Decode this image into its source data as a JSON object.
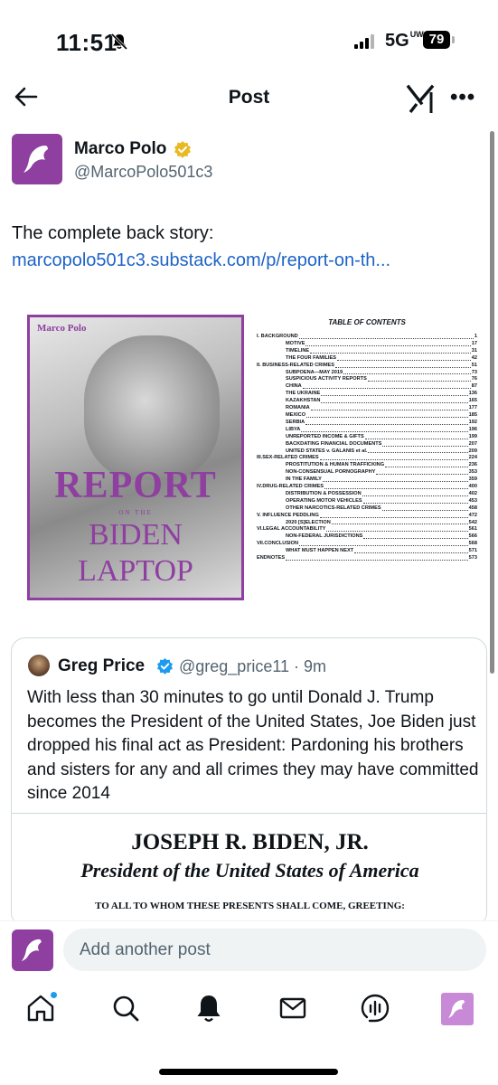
{
  "status_bar": {
    "time": "11:51",
    "network": "5G",
    "network_sub": "UW",
    "battery": "79"
  },
  "header": {
    "title": "Post"
  },
  "post": {
    "author_name": "Marco Polo",
    "author_handle": "@MarcoPolo501c3",
    "text": "The complete back story:",
    "link": "marcopolo501c3.substack.com/p/report-on-th..."
  },
  "media": {
    "cover": {
      "brand": "Marco Polo",
      "line1": "REPORT",
      "line2": "ON THE",
      "line3": "BIDEN",
      "line4": "LAPTOP"
    },
    "toc_title": "TABLE OF CONTENTS",
    "toc": [
      {
        "label": "I. BACKGROUND",
        "page": "1",
        "sub": false
      },
      {
        "label": "MOTIVE",
        "page": "17",
        "sub": true
      },
      {
        "label": "TIMELINE",
        "page": "31",
        "sub": true
      },
      {
        "label": "THE FOUR FAMILIES",
        "page": "42",
        "sub": true
      },
      {
        "label": "II. BUSINESS-RELATED CRIMES",
        "page": "51",
        "sub": false
      },
      {
        "label": "SUBPOENA—MAY 2019",
        "page": "73",
        "sub": true
      },
      {
        "label": "SUSPICIOUS ACTIVITY REPORTS",
        "page": "76",
        "sub": true
      },
      {
        "label": "CHINA",
        "page": "87",
        "sub": true
      },
      {
        "label": "THE UKRAINE",
        "page": "136",
        "sub": true
      },
      {
        "label": "KAZAKHSTAN",
        "page": "165",
        "sub": true
      },
      {
        "label": "ROMANIA",
        "page": "177",
        "sub": true
      },
      {
        "label": "MEXICO",
        "page": "185",
        "sub": true
      },
      {
        "label": "SERBIA",
        "page": "192",
        "sub": true
      },
      {
        "label": "LIBYA",
        "page": "196",
        "sub": true
      },
      {
        "label": "UNREPORTED INCOME & GIFTS",
        "page": "199",
        "sub": true
      },
      {
        "label": "BACKDATING FINANCIAL DOCUMENTS",
        "page": "207",
        "sub": true
      },
      {
        "label": "UNITED STATES v. GALANIS et al.",
        "page": "209",
        "sub": true
      },
      {
        "label": "III.SEX-RELATED CRIMES",
        "page": "224",
        "sub": false
      },
      {
        "label": "PROSTITUTION & HUMAN TRAFFICKING",
        "page": "236",
        "sub": true
      },
      {
        "label": "NON-CONSENSUAL PORNOGRAPHY",
        "page": "353",
        "sub": true
      },
      {
        "label": "IN THE FAMILY",
        "page": "359",
        "sub": true
      },
      {
        "label": "IV.DRUG-RELATED CRIMES",
        "page": "400",
        "sub": false
      },
      {
        "label": "DISTRIBUTION & POSSESSION",
        "page": "402",
        "sub": true
      },
      {
        "label": "OPERATING MOTOR VEHICLES",
        "page": "453",
        "sub": true
      },
      {
        "label": "OTHER NARCOTICS-RELATED CRIMES",
        "page": "458",
        "sub": true
      },
      {
        "label": "V. INFLUENCE PEDDLING",
        "page": "472",
        "sub": false
      },
      {
        "label": "2020 [S]ELECTION",
        "page": "542",
        "sub": true
      },
      {
        "label": "VI.LEGAL ACCOUNTABILITY",
        "page": "561",
        "sub": false
      },
      {
        "label": "NON-FEDERAL JURISDICTIONS",
        "page": "566",
        "sub": true
      },
      {
        "label": "VII.CONCLUSION",
        "page": "568",
        "sub": false
      },
      {
        "label": "WHAT MUST HAPPEN NEXT",
        "page": "571",
        "sub": true
      },
      {
        "label": "ENDNOTES",
        "page": "573",
        "sub": false
      }
    ]
  },
  "quote": {
    "author_name": "Greg Price",
    "author_handle": "@greg_price11 · 9m",
    "text": "With less than 30 minutes to go until Donald J. Trump becomes the President of the United States, Joe Biden just dropped his final act as President: Pardoning his brothers and sisters for any and all crimes they may have committed since 2014",
    "doc_line1": "JOSEPH R. BIDEN, JR.",
    "doc_line2": "President of the United States of America",
    "doc_line3": "TO ALL TO WHOM THESE PRESENTS SHALL COME, GREETING:"
  },
  "reply": {
    "placeholder": "Add another post"
  },
  "nav": {
    "items": [
      "home-icon",
      "search-icon",
      "notifications-icon",
      "messages-icon",
      "grok-voice-icon",
      "profile-icon"
    ]
  },
  "colors": {
    "brand_purple": "#8e3fa0",
    "link_blue": "#1d63c8",
    "verified_gold": "#e8b923",
    "verified_blue": "#1d9bf0"
  }
}
